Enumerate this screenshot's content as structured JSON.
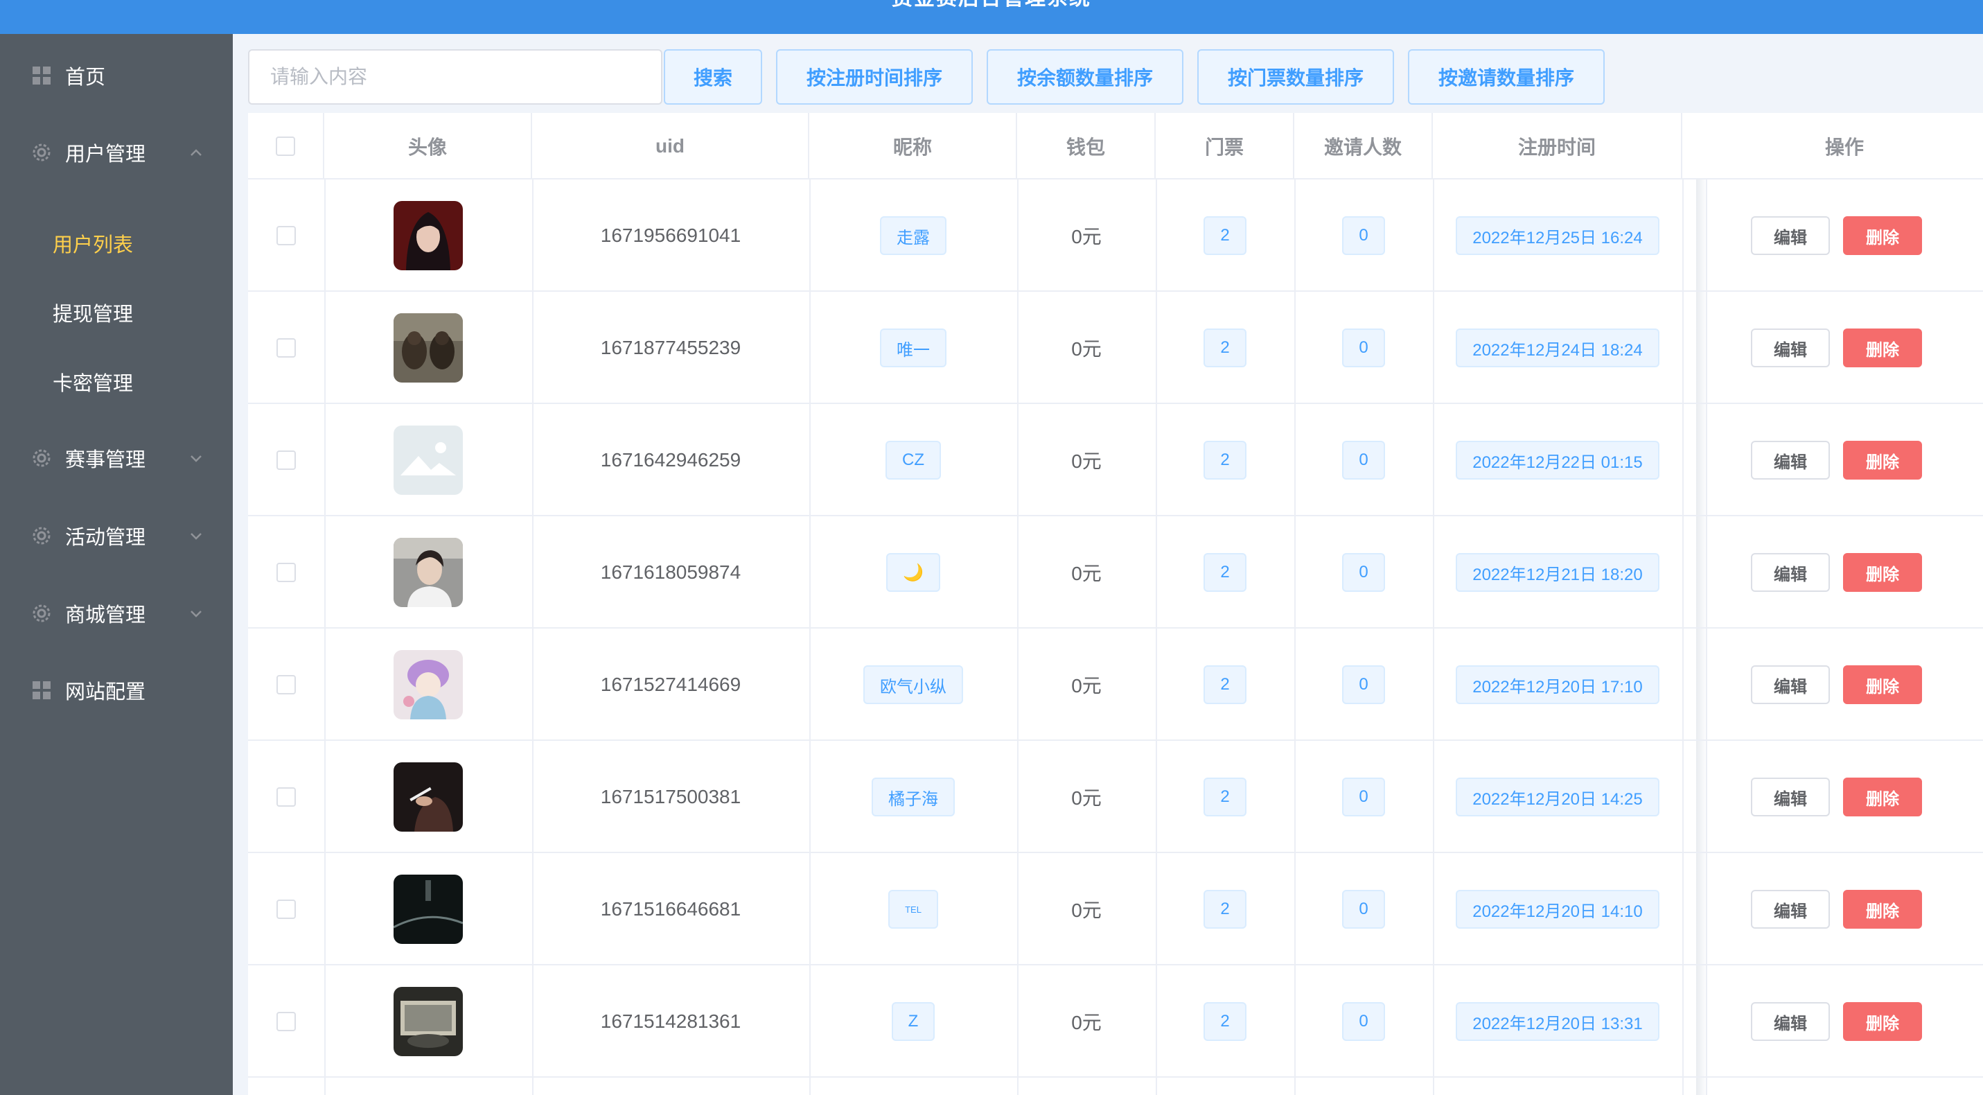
{
  "header": {
    "title": "赏金赛后台管理系统"
  },
  "sidebar": {
    "items": [
      {
        "label": "首页",
        "icon": "grid-icon"
      },
      {
        "label": "用户管理",
        "icon": "gear-icon",
        "expanded": true,
        "children": [
          {
            "label": "用户列表",
            "active": true
          },
          {
            "label": "提现管理"
          },
          {
            "label": "卡密管理"
          }
        ]
      },
      {
        "label": "赛事管理",
        "icon": "gear-icon"
      },
      {
        "label": "活动管理",
        "icon": "gear-icon"
      },
      {
        "label": "商城管理",
        "icon": "gear-icon"
      },
      {
        "label": "网站配置",
        "icon": "grid-icon"
      }
    ]
  },
  "toolbar": {
    "search_placeholder": "请输入内容",
    "search_button": "搜索",
    "sort_reg_time": "按注册时间排序",
    "sort_balance": "按余额数量排序",
    "sort_tickets": "按门票数量排序",
    "sort_invites": "按邀请数量排序"
  },
  "table": {
    "columns": {
      "avatar": "头像",
      "uid": "uid",
      "nickname": "昵称",
      "wallet": "钱包",
      "tickets": "门票",
      "invites": "邀请人数",
      "reg_time": "注册时间",
      "actions": "操作"
    },
    "edit_label": "编辑",
    "delete_label": "删除",
    "rows": [
      {
        "uid": "1671956691041",
        "nickname": "走露",
        "wallet": "0元",
        "tickets": "2",
        "invites": "0",
        "reg_time": "2022年12月25日 16:24"
      },
      {
        "uid": "1671877455239",
        "nickname": "唯一",
        "wallet": "0元",
        "tickets": "2",
        "invites": "0",
        "reg_time": "2022年12月24日 18:24"
      },
      {
        "uid": "1671642946259",
        "nickname": "CZ",
        "wallet": "0元",
        "tickets": "2",
        "invites": "0",
        "reg_time": "2022年12月22日 01:15"
      },
      {
        "uid": "1671618059874",
        "nickname": "🌙",
        "wallet": "0元",
        "tickets": "2",
        "invites": "0",
        "reg_time": "2022年12月21日 18:20"
      },
      {
        "uid": "1671527414669",
        "nickname": "欧气小纵",
        "wallet": "0元",
        "tickets": "2",
        "invites": "0",
        "reg_time": "2022年12月20日 17:10"
      },
      {
        "uid": "1671517500381",
        "nickname": "橘子海",
        "wallet": "0元",
        "tickets": "2",
        "invites": "0",
        "reg_time": "2022年12月20日 14:25"
      },
      {
        "uid": "1671516646681",
        "nickname": "TEL",
        "wallet": "0元",
        "tickets": "2",
        "invites": "0",
        "reg_time": "2022年12月20日 14:10"
      },
      {
        "uid": "1671514281361",
        "nickname": "Z",
        "wallet": "0元",
        "tickets": "2",
        "invites": "0",
        "reg_time": "2022年12月20日 13:31"
      }
    ]
  },
  "colors": {
    "header": "#3a8ee6",
    "sidebar": "#545c64",
    "active_menu": "#ffd04b",
    "primary": "#409eff",
    "danger": "#f56c6c"
  }
}
